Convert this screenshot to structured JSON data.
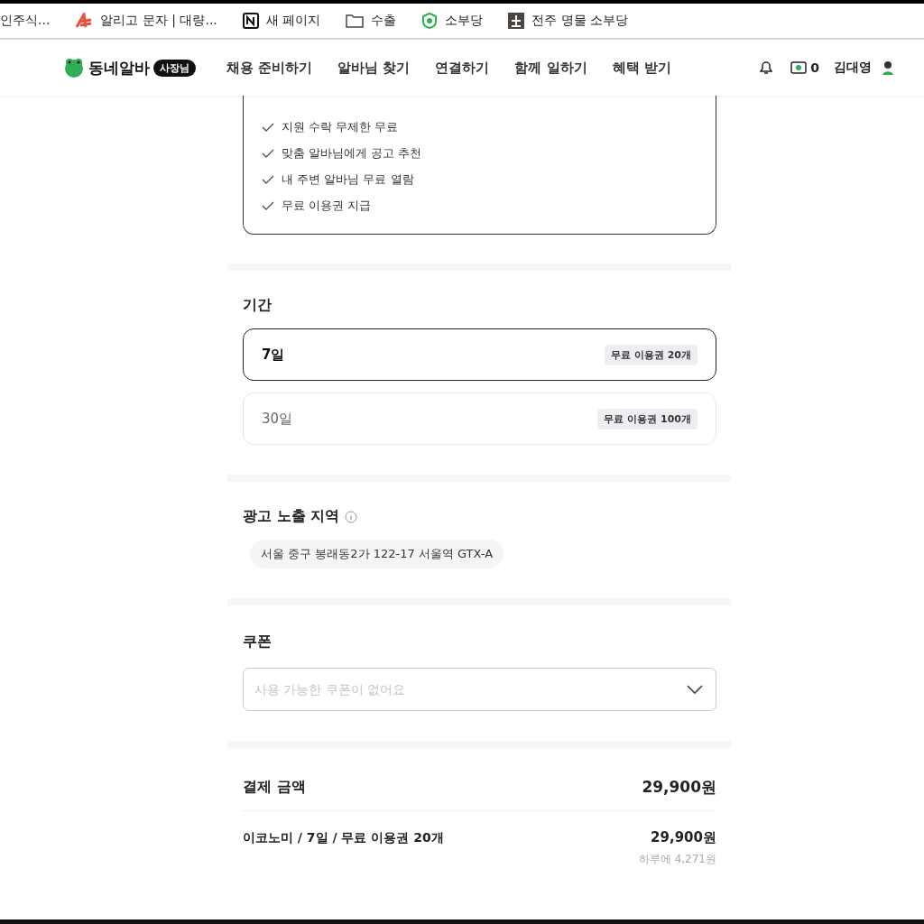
{
  "bookmarks": [
    {
      "label": "인주식...",
      "kind": "none"
    },
    {
      "label": "알리고 문자 | 대량...",
      "kind": "a-logo"
    },
    {
      "label": "새 페이지",
      "kind": "n-logo"
    },
    {
      "label": "수출",
      "kind": "folder"
    },
    {
      "label": "소부당",
      "kind": "shield"
    },
    {
      "label": "전주 명물 소부당",
      "kind": "tile"
    }
  ],
  "header": {
    "logo": "동네알바",
    "logo_badge": "사장님",
    "nav": [
      "채용 준비하기",
      "알바님 찾기",
      "연결하기",
      "함께 일하기",
      "혜택 받기"
    ],
    "points": "0",
    "user": "김대영"
  },
  "benefits": [
    "지원 수락 무제한 무료",
    "맞춤 알바님에게 공고 추천",
    "내 주변 알바님 무료 열람",
    "무료 이용권 지급"
  ],
  "period": {
    "title": "기간",
    "options": [
      {
        "label": "7일",
        "tag": "무료 이용권 20개",
        "selected": true
      },
      {
        "label": "30일",
        "tag": "무료 이용권 100개",
        "selected": false
      }
    ]
  },
  "region": {
    "title": "광고 노출 지역",
    "address": "서울 중구 봉래동2가 122-17 서울역 GTX-A"
  },
  "coupon": {
    "title": "쿠폰",
    "placeholder": "사용 가능한 쿠폰이 없어요"
  },
  "payment": {
    "title": "결제 금액",
    "total": "29,900원",
    "item": "이코노미 / 7일 / 무료 이용권 20개",
    "price": "29,900원",
    "per_day": "하루에 4,271원"
  }
}
